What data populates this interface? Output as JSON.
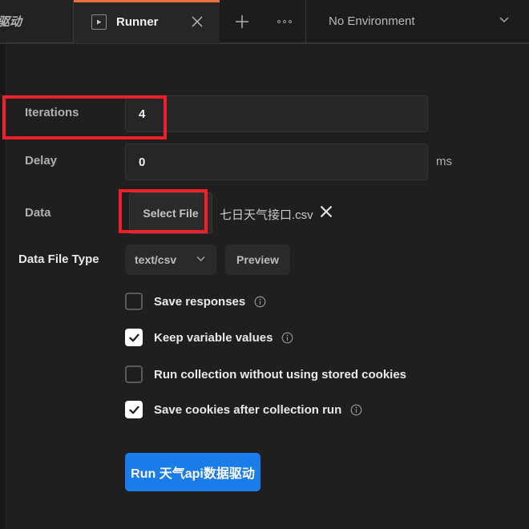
{
  "window": {
    "background_color": "#1c1c1c",
    "panel_color": "#1f1f1f"
  },
  "tabbar": {
    "previous_tab_label": "据驱动",
    "active_tab": {
      "label": "Runner",
      "icon": "play-icon",
      "close_icon": "close-icon",
      "accent_color": "#e8703a"
    },
    "new_tab_icon": "plus-icon",
    "more_options_icon": "ellipsis-icon",
    "environment": {
      "label": "No Environment",
      "chevron_icon": "chevron-down-icon"
    }
  },
  "form": {
    "iterations": {
      "label": "Iterations",
      "value": "4"
    },
    "delay": {
      "label": "Delay",
      "value": "0",
      "unit": "ms"
    },
    "data": {
      "label": "Data",
      "select_file_label": "Select File",
      "file_name": "七日天气接口.csv",
      "remove_icon": "close-icon"
    },
    "data_file_type": {
      "label": "Data File Type",
      "selected": "text/csv",
      "chevron_icon": "chevron-down-icon",
      "preview_label": "Preview"
    },
    "options": [
      {
        "label": "Save responses",
        "checked": false,
        "info": true
      },
      {
        "label": "Keep variable values",
        "checked": true,
        "info": true
      },
      {
        "label": "Run collection without using stored cookies",
        "checked": false,
        "info": false
      },
      {
        "label": "Save cookies after collection run",
        "checked": true,
        "info": true
      }
    ],
    "run_button": {
      "label": "Run 天气api数据驱动",
      "color": "#1a7ce8"
    }
  },
  "annotations": {
    "color": "#f01f28",
    "boxes": [
      {
        "target": "iterations-row"
      },
      {
        "target": "select-file-button"
      }
    ]
  }
}
